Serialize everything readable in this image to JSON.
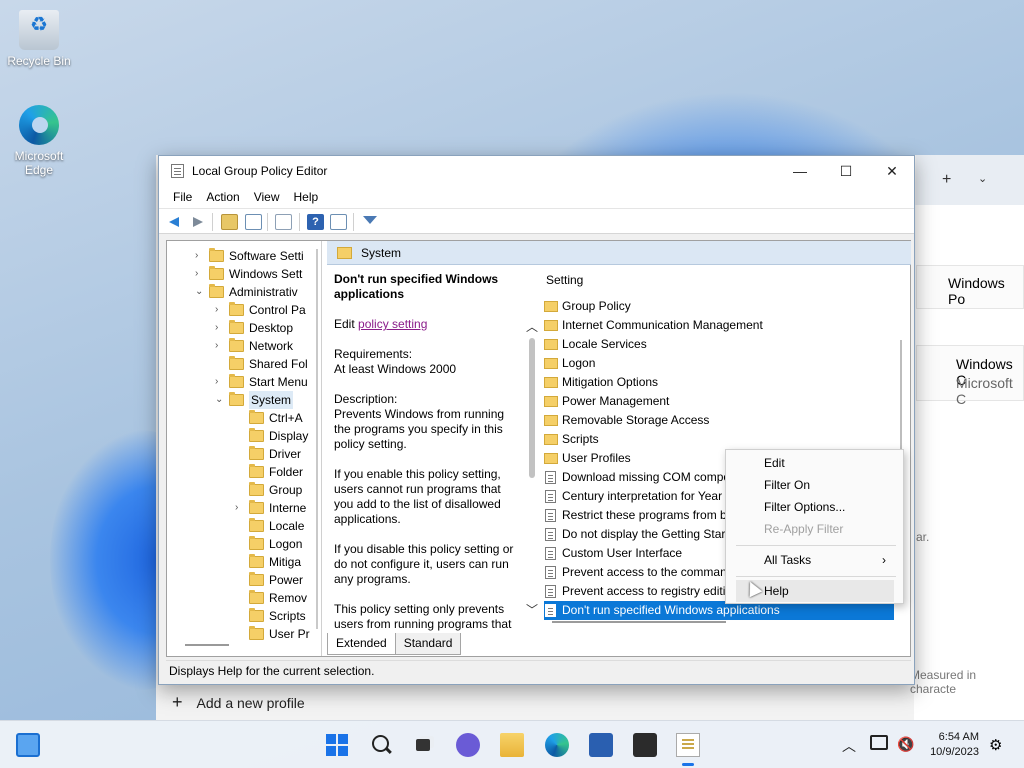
{
  "desktop": {
    "icons": [
      {
        "label": "Recycle Bin",
        "icon": "recycle-bin-icon"
      },
      {
        "label": "Microsoft Edge",
        "icon": "edge-icon"
      }
    ]
  },
  "background_window": {
    "item1": "Windows Po",
    "item2": "Windows C",
    "item3": "Microsoft C",
    "item4": "Measured in characte",
    "item5": "ar.",
    "add_profile": "Add a new profile"
  },
  "window": {
    "title": "Local Group Policy Editor",
    "controls": {
      "minimize": "—",
      "maximize": "☐",
      "close": "✕"
    },
    "menu": [
      "File",
      "Action",
      "View",
      "Help"
    ],
    "tree": [
      {
        "label": "Software Setti",
        "expander": "›"
      },
      {
        "label": "Windows Sett",
        "expander": "›"
      },
      {
        "label": "Administrativ",
        "expander": "⌄"
      },
      {
        "label": "Control Pa",
        "expander": "›"
      },
      {
        "label": "Desktop",
        "expander": "›"
      },
      {
        "label": "Network",
        "expander": "›"
      },
      {
        "label": "Shared Fol",
        "expander": ""
      },
      {
        "label": "Start Menu",
        "expander": "›"
      },
      {
        "label": "System",
        "expander": "⌄"
      },
      {
        "label": "Ctrl+A",
        "expander": ""
      },
      {
        "label": "Display",
        "expander": ""
      },
      {
        "label": "Driver",
        "expander": ""
      },
      {
        "label": "Folder",
        "expander": ""
      },
      {
        "label": "Group",
        "expander": ""
      },
      {
        "label": "Interne",
        "expander": "›"
      },
      {
        "label": "Locale",
        "expander": ""
      },
      {
        "label": "Logon",
        "expander": ""
      },
      {
        "label": "Mitiga",
        "expander": ""
      },
      {
        "label": "Power",
        "expander": ""
      },
      {
        "label": "Remov",
        "expander": ""
      },
      {
        "label": "Scripts",
        "expander": ""
      },
      {
        "label": "User Pr",
        "expander": ""
      }
    ],
    "pane_header": "System",
    "description": {
      "title": "Don't run specified Windows applications",
      "edit_prefix": "Edit ",
      "edit_link": "policy setting",
      "requirements_label": "Requirements:",
      "requirements": "At least Windows 2000",
      "description_label": "Description:",
      "p1": "Prevents Windows from running the programs you specify in this policy setting.",
      "p2": "If you enable this policy setting, users cannot run programs that you add to the list of disallowed applications.",
      "p3": "If you disable this policy setting or do not configure it, users can run any programs.",
      "p4": "This policy setting only prevents users from running programs that"
    },
    "list_header": "Setting",
    "settings": [
      {
        "label": "Group Policy",
        "kind": "folder"
      },
      {
        "label": "Internet Communication Management",
        "kind": "folder"
      },
      {
        "label": "Locale Services",
        "kind": "folder"
      },
      {
        "label": "Logon",
        "kind": "folder"
      },
      {
        "label": "Mitigation Options",
        "kind": "folder"
      },
      {
        "label": "Power Management",
        "kind": "folder"
      },
      {
        "label": "Removable Storage Access",
        "kind": "folder"
      },
      {
        "label": "Scripts",
        "kind": "folder"
      },
      {
        "label": "User Profiles",
        "kind": "folder"
      },
      {
        "label": "Download missing COM compo",
        "kind": "policy"
      },
      {
        "label": "Century interpretation for Year 2",
        "kind": "policy"
      },
      {
        "label": "Restrict these programs from be",
        "kind": "policy"
      },
      {
        "label": "Do not display the Getting Start",
        "kind": "policy"
      },
      {
        "label": "Custom User Interface",
        "kind": "policy"
      },
      {
        "label": "Prevent access to the command",
        "kind": "policy"
      },
      {
        "label": "Prevent access to registry editin",
        "kind": "policy"
      },
      {
        "label": "Don't run specified Windows applications",
        "kind": "policy",
        "selected": true
      }
    ],
    "tabs": [
      "Extended",
      "Standard"
    ],
    "status": "Displays Help for the current selection."
  },
  "context_menu": {
    "edit": "Edit",
    "filter_on": "Filter On",
    "filter_options": "Filter Options...",
    "reapply_filter": "Re-Apply Filter",
    "all_tasks": "All Tasks",
    "all_tasks_arrow": "›",
    "help": "Help"
  },
  "taskbar": {
    "time": "6:54 AM",
    "date": "10/9/2023",
    "apps": [
      "widgets-icon",
      "start-icon",
      "search-icon",
      "task-view-icon",
      "chat-icon",
      "file-explorer-icon",
      "edge-icon",
      "store-icon",
      "terminal-icon",
      "group-policy-editor-icon"
    ]
  },
  "colors": {
    "selection": "#0b78d7",
    "accent": "#1a73e8"
  }
}
